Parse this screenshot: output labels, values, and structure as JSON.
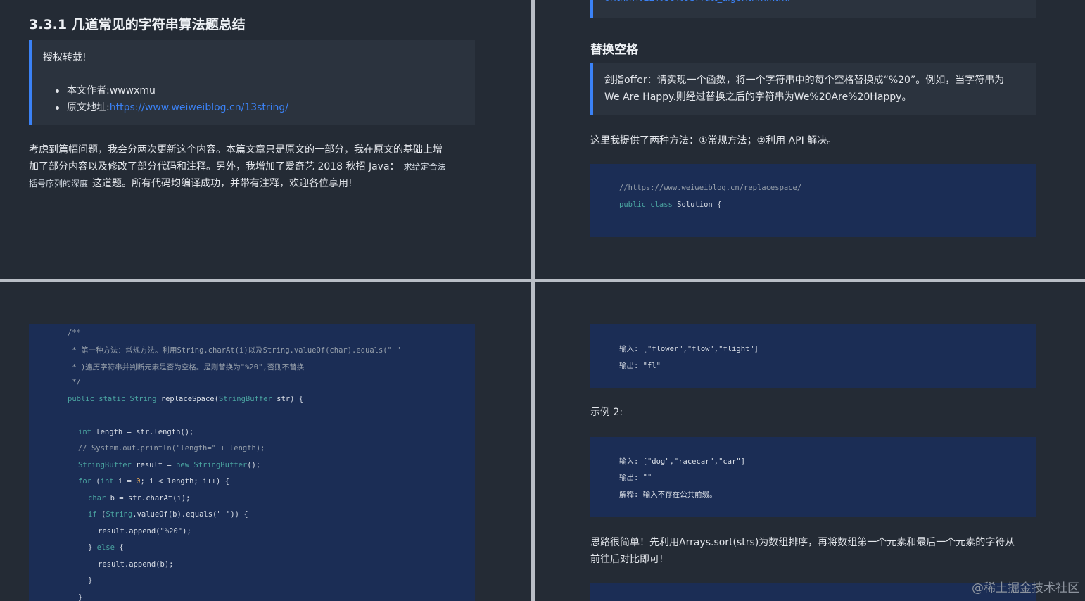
{
  "q1": {
    "heading": "3.3.1 几道常见的字符串算法题总结",
    "quote_title": "授权转载!",
    "author_label": "本文作者:",
    "author_value": "wwwxmu",
    "source_label": "原文地址:",
    "source_url": "https://www.weiweiblog.cn/13string/",
    "para_line1": "考虑到篇幅问题，我会分两次更新这个内容。本篇文章只是原文的一部分，我在原文的基础上增",
    "para_line2": "加了部分内容以及修改了部分代码和注释。另外，我增加了爱奇艺 2018 秋招 Java：",
    "para_code1": "求给定合法",
    "para_code2": "括号序列的深度",
    "para_line3": "这道题。所有代码均编译成功，并带有注释，欢迎各位享用!"
  },
  "q2": {
    "top_link": "orithm%E2%80%93Pratt_algorithm.html",
    "heading": "替换空格",
    "quote_line1": "剑指offer：请实现一个函数，将一个字符串中的每个空格替换成“%20”。例如，当字符串为",
    "quote_line2": "We Are Happy.则经过替换之后的字符串为We%20Are%20Happy。",
    "para": "这里我提供了两种方法：①常规方法；②利用 API 解决。",
    "code_comment": "//https://www.weiweiblog.cn/replacespace/",
    "code_kw": "public class",
    "code_name": " Solution {"
  },
  "q3": {
    "c1": "/**",
    "c2": " * 第一种方法：常规方法。利用String.charAt(i)以及String.valueOf(char).equals(\" \"",
    "c3": " * )遍历字符串并判断元素是否为空格。是则替换为\"%20\",否则不替换",
    "c4": " */",
    "s1_kw": "public static",
    "s1_tp": " String",
    "s1_rest": " replaceSpace(",
    "s1_tp2": "StringBuffer",
    "s1_end": " str) {",
    "l1_tp": "int",
    "l1_rest": " length = str.length();",
    "l2": "// System.out.println(\"length=\" + length);",
    "l3_tp": "StringBuffer",
    "l3_mid": " result = ",
    "l3_kw": "new",
    "l3_tp2": " StringBuffer",
    "l3_end": "();",
    "l4_kw": "for",
    "l4_a": " (",
    "l4_tp": "int",
    "l4_b": " i = ",
    "l4_num": "0",
    "l4_c": "; i < length; i++) {",
    "l5_tp": "char",
    "l5_rest": " b = str.charAt(i);",
    "l6_kw": "if",
    "l6_a": " (",
    "l6_tp": "String",
    "l6_b": ".valueOf(b).equals(\" \")) {",
    "l7_a": "result.append(",
    "l7_str": "\"%20\"",
    "l7_b": ");",
    "l8_a": "} ",
    "l8_kw": "else",
    "l8_b": " {",
    "l9": "result.append(b);",
    "l10": "}",
    "l11": "}"
  },
  "q4": {
    "ex1_in": "输入: [\"flower\",\"flow\",\"flight\"]",
    "ex1_out": "输出: \"fl\"",
    "ex2_label": "示例 2:",
    "ex2_in": "输入: [\"dog\",\"racecar\",\"car\"]",
    "ex2_out": "输出: \"\"",
    "ex2_exp": "解释: 输入不存在公共前缀。",
    "para_line1": "思路很简单！先利用Arrays.sort(strs)为数组排序，再将数组第一个元素和最后一个元素的字符从",
    "para_line2": "前往后对比即可!",
    "watermark": "@稀土掘金技术社区"
  }
}
